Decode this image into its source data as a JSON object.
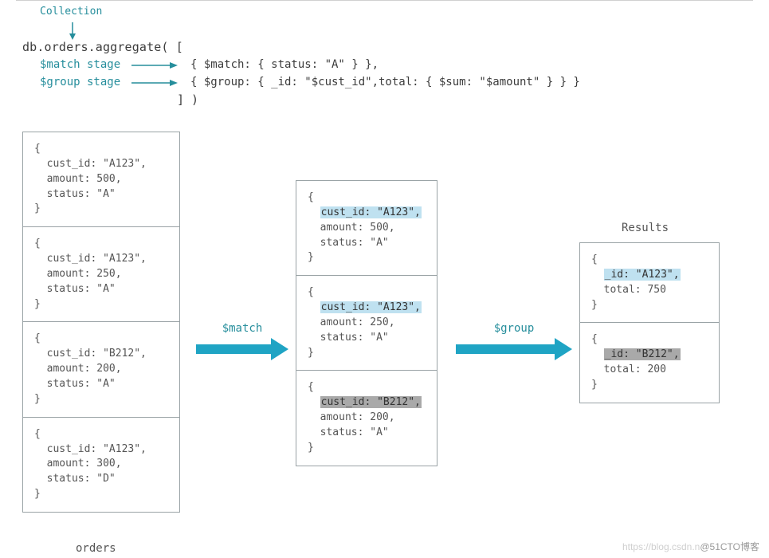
{
  "header": {
    "collection_label": "Collection",
    "top_line": "db.orders.aggregate( [",
    "match_label": "$match stage",
    "match_code": "{ $match: { status: \"A\" } },",
    "group_label": "$group stage",
    "group_code": "{ $group: { _id: \"$cust_id\",total: { $sum: \"$amount\" } } }",
    "close_line": "] )"
  },
  "col1_title": "orders",
  "col3_title": "Results",
  "col1": [
    {
      "a": "cust_id: \"A123\",",
      "b": "amount: 500,",
      "c": "status: \"A\""
    },
    {
      "a": "cust_id: \"A123\",",
      "b": "amount: 250,",
      "c": "status: \"A\""
    },
    {
      "a": "cust_id: \"B212\",",
      "b": "amount: 200,",
      "c": "status: \"A\""
    },
    {
      "a": "cust_id: \"A123\",",
      "b": "amount: 300,",
      "c": "status: \"D\""
    }
  ],
  "col2": [
    {
      "hl": "cust_id: \"A123\",",
      "hlclass": "hl-blue",
      "b": "amount: 500,",
      "c": "status: \"A\""
    },
    {
      "hl": "cust_id: \"A123\",",
      "hlclass": "hl-blue",
      "b": "amount: 250,",
      "c": "status: \"A\""
    },
    {
      "hl": "cust_id: \"B212\",",
      "hlclass": "hl-gray",
      "b": "amount: 200,",
      "c": "status: \"A\""
    }
  ],
  "col3": [
    {
      "hl": "_id: \"A123\",",
      "hlclass": "hl-blue",
      "b": "total: 750"
    },
    {
      "hl": "_id: \"B212\",",
      "hlclass": "hl-gray",
      "b": "total: 200"
    }
  ],
  "arrow1_label": "$match",
  "arrow2_label": "$group",
  "watermark_light": "https://blog.csdn.n",
  "watermark_dark": "@51CTO博客"
}
